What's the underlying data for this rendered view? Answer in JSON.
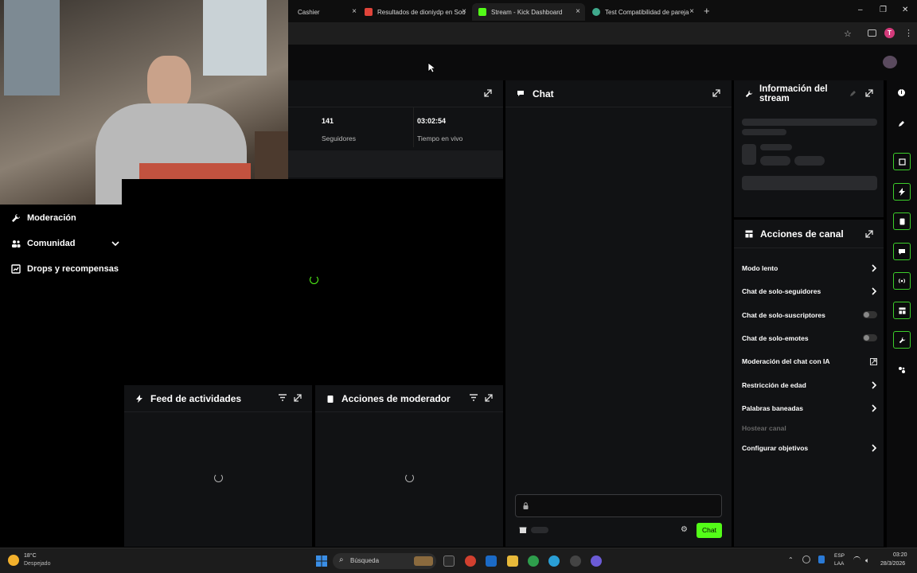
{
  "browser": {
    "tabs": [
      {
        "label": "Cashier",
        "active": false
      },
      {
        "label": "Resultados de dioniydp en Sou",
        "active": false
      },
      {
        "label": "Stream - Kick Dashboard",
        "active": true
      },
      {
        "label": "Test Compatibilidad de pareja",
        "active": false
      }
    ],
    "new_tab": "+",
    "window_controls": {
      "minimize": "–",
      "maximize": "❐",
      "close": "✕"
    },
    "profile_initial": "T"
  },
  "sidebar": {
    "items": [
      {
        "label": "Moderación",
        "icon": "wrench-icon",
        "has_chevron": false
      },
      {
        "label": "Comunidad",
        "icon": "people-icon",
        "has_chevron": true
      },
      {
        "label": "Drops y recompensas",
        "icon": "gift-icon",
        "has_chevron": false
      }
    ]
  },
  "stats": {
    "followers_value": "141",
    "followers_label": "Seguidores",
    "live_time_value": "03:02:54",
    "live_time_label": "Tiempo en vivo"
  },
  "chat": {
    "title": "Chat",
    "send_button": "Chat",
    "input_placeholder": ""
  },
  "activity_feed": {
    "title": "Feed de actividades"
  },
  "mod_actions": {
    "title": "Acciones de moderador"
  },
  "stream_info": {
    "title": "Información del stream"
  },
  "channel_actions": {
    "title": "Acciones de canal",
    "items": [
      {
        "label": "Modo lento",
        "trail": "chevron"
      },
      {
        "label": "Chat de solo-seguidores",
        "trail": "chevron"
      },
      {
        "label": "Chat de solo-suscriptores",
        "trail": "toggle",
        "enabled": false
      },
      {
        "label": "Chat de solo-emotes",
        "trail": "toggle",
        "enabled": false
      },
      {
        "label": "Moderación del chat con IA",
        "trail": "external"
      },
      {
        "label": "Restricción de edad",
        "trail": "chevron"
      },
      {
        "label": "Palabras baneadas",
        "trail": "chevron"
      },
      {
        "label": "Hostear canal",
        "trail": "none",
        "disabled": true
      },
      {
        "label": "Configurar objetivos",
        "trail": "chevron"
      }
    ]
  },
  "taskbar": {
    "weather_temp": "18°C",
    "weather_desc": "Despejado",
    "search_label": "Búsqueda",
    "lang_line1": "ESP",
    "lang_line2": "LAA",
    "time": "03:20",
    "date": "28/3/2026"
  },
  "colors": {
    "accent": "#53fc18",
    "panel": "#111214",
    "background": "#000000"
  }
}
